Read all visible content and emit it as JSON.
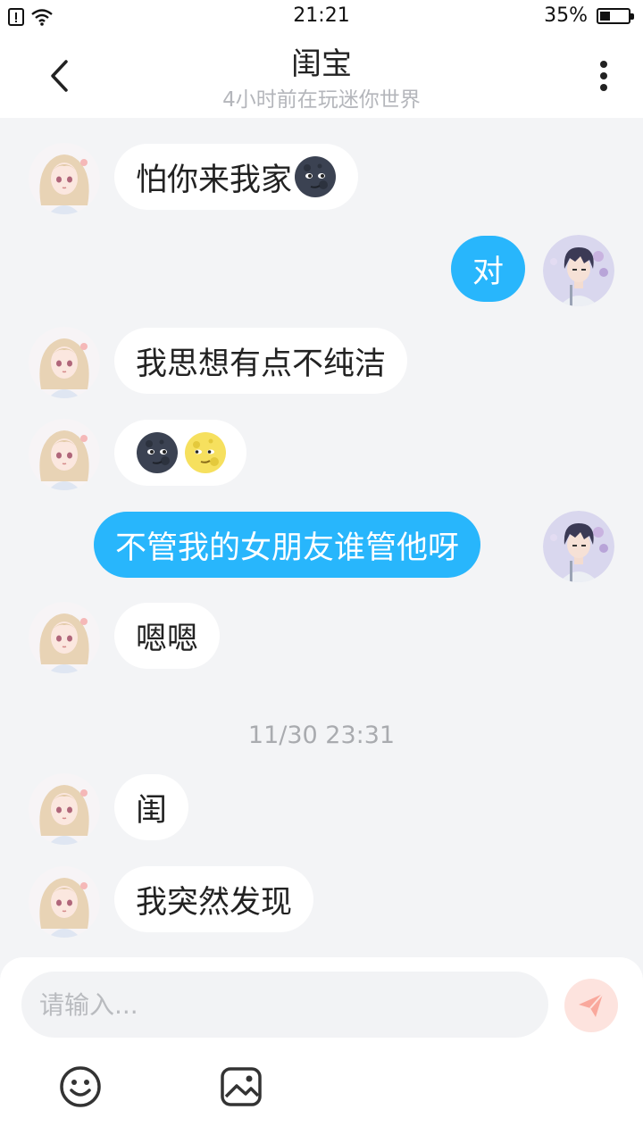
{
  "status_bar": {
    "time": "21:21",
    "battery": "35%",
    "battery_level": 0.35
  },
  "header": {
    "title": "闺宝",
    "subtitle": "4小时前在玩迷你世界"
  },
  "messages": [
    {
      "side": "in",
      "text": "怕你来我家",
      "emoji": [
        "new-moon-face"
      ]
    },
    {
      "side": "out",
      "text": "对"
    },
    {
      "side": "in",
      "text": "我思想有点不纯洁"
    },
    {
      "side": "in",
      "text": "",
      "emoji": [
        "new-moon-face",
        "full-moon-face"
      ]
    },
    {
      "side": "out",
      "text": "不管我的女朋友谁管他呀"
    },
    {
      "side": "in",
      "text": "嗯嗯"
    },
    {
      "side": "in",
      "text": "闺"
    },
    {
      "side": "in",
      "text": "我突然发现"
    }
  ],
  "timestamp": "11/30 23:31",
  "composer": {
    "placeholder": "请输入...",
    "send_icon": "send-icon"
  },
  "toolbar": {
    "emoji_icon": "smiley-icon",
    "image_icon": "image-icon"
  },
  "colors": {
    "outgoing_bubble": "#28b6fc",
    "incoming_bubble": "#ffffff",
    "background": "#f3f4f6",
    "send_button": "#fde3de"
  }
}
